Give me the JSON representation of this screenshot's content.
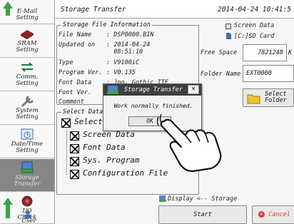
{
  "sidebar": {
    "items": [
      {
        "label": "E-Mail\nSetting",
        "icon": "email-icon"
      },
      {
        "label": "SRAM\nSetting",
        "icon": "sram-chip-icon"
      },
      {
        "label": "Comm.\nSetting",
        "icon": "communication-icon"
      },
      {
        "label": "System\nSetting",
        "icon": "wrench-icon"
      },
      {
        "label": "Date/Time\nSetting",
        "icon": "clock-icon"
      },
      {
        "label": "Storage\nTransfer",
        "icon": "storage-transfer-icon"
      },
      {
        "label": "I/O\nCheck",
        "icon": "io-check-icon"
      },
      {
        "label": "User",
        "icon": "user-icon"
      }
    ],
    "active_index": 5
  },
  "header": {
    "title": "Storage Transfer",
    "datetime": "2014-04-24  10:41:5"
  },
  "file_info": {
    "legend": "Storage File Information",
    "rows": [
      {
        "label": "File Name",
        "value": ": DSP0000.BIN"
      },
      {
        "label": "Updated on",
        "value": ": 2014-04-24\n  08:51:10"
      },
      {
        "label": "Type",
        "value": ": V9100iC"
      },
      {
        "label": "Program Ver.",
        "value": ": V0.135"
      },
      {
        "label": "Font Data",
        "value": ": Jpn. Gothic TTF"
      },
      {
        "label": "Font Ver.",
        "value": ""
      },
      {
        "label": "Comment",
        "value": ""
      }
    ]
  },
  "screen_data": {
    "label": "Screen Data",
    "sd_label": "[C:]SD Card",
    "free_space_label": "Free Space",
    "free_space_value": "7821248",
    "free_space_unit": "K",
    "folder_name_label": "Folder Name",
    "folder_name_value": "EXT0000",
    "select_folder_label": "Select\nFolder"
  },
  "select_data": {
    "legend": "Select Data",
    "options": [
      "Select",
      "Screen Data",
      "Font Data",
      "Sys. Program",
      "Configuration File"
    ]
  },
  "bottom": {
    "direction_label": "Display <-- Storage",
    "start_label": "Start",
    "cancel_label": "Cancel"
  },
  "dialog": {
    "title": "Storage Transfer",
    "close": "×",
    "message": "Work normally finished.",
    "ok_label": "OK"
  },
  "colors": {
    "active_sidebar": "#858585",
    "dialog_title": "#3f3f3f",
    "cancel_icon": "#e03a3a"
  }
}
